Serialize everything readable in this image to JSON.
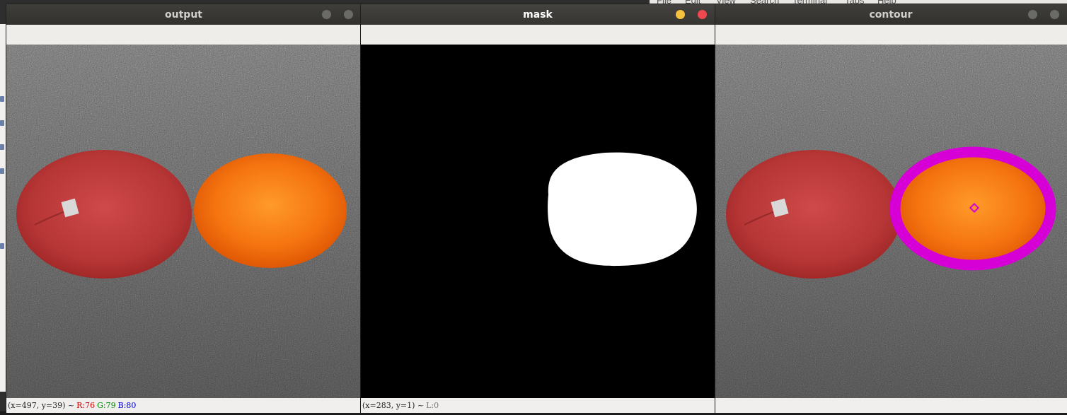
{
  "background": {
    "menubar": {
      "items": [
        "File",
        "Edit",
        "View",
        "Search",
        "Terminal",
        "Tabs",
        "Help"
      ]
    }
  },
  "windows": {
    "output": {
      "title": "output",
      "status": {
        "coords": "(x=497, y=39) ~",
        "r": "R:76",
        "g": "G:79",
        "b": "B:80"
      }
    },
    "mask": {
      "title": "mask",
      "status": {
        "coords": "(x=283, y=1) ~",
        "l": "L:0"
      }
    },
    "contour": {
      "title": "contour"
    }
  },
  "colors": {
    "titlebar": "#353431",
    "minimize_active": "#f6c13d",
    "close_active": "#ef4850",
    "contour_stroke": "#d600d6",
    "red_channel": "#d00000",
    "green_channel": "#008800",
    "blue_channel": "#0000cc",
    "l_channel": "#777777"
  }
}
